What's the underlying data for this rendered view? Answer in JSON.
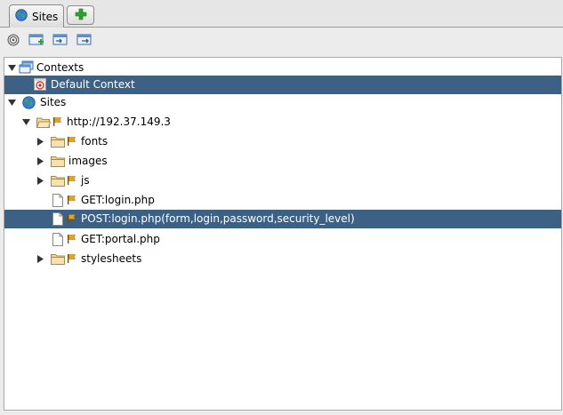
{
  "tabs": {
    "sites_label": "Sites"
  },
  "tree": {
    "contexts_label": "Contexts",
    "default_context_label": "Default Context",
    "sites_label": "Sites",
    "host_label": "http://192.37.149.3",
    "children": {
      "fonts": "fonts",
      "images": "images",
      "js": "js",
      "get_login": "GET:login.php",
      "post_login": "POST:login.php(form,login,password,security_level)",
      "get_portal": "GET:portal.php",
      "stylesheets": "stylesheets"
    }
  },
  "colors": {
    "selection": "#3d6185",
    "folder": "#f2d69a",
    "flag": "#e8a21c",
    "add_green": "#2fa52f"
  },
  "icons": {
    "tab": "globe-icon",
    "add": "plus-icon",
    "toolbar": [
      "target-icon",
      "new-context-icon",
      "import-context-icon",
      "export-context-icon"
    ]
  }
}
